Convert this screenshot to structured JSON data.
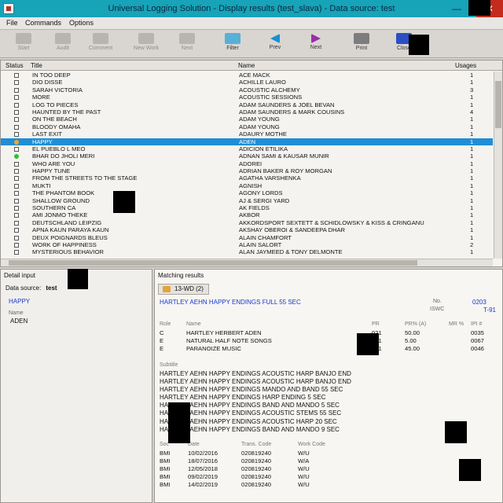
{
  "window": {
    "title": "Universal Logging Solution  -  Display results (test_slava) - Data source: test",
    "minimize_glyph": "—",
    "maximize_glyph": "☐",
    "close_glyph": "✕",
    "close_color": "#c42b1c",
    "titlebar_color": "#17a3b8"
  },
  "menu": {
    "file": "File",
    "commands": "Commands",
    "options": "Options"
  },
  "toolbar": {
    "start_label": "Start",
    "audit_label": "Audit",
    "comment_label": "Comment",
    "new_work_label": "New Work",
    "next_disabled_label": "Next",
    "filter_label": "Filter",
    "prev_label": "Prev",
    "next_label": "Next",
    "print_label": "Print",
    "close_label": "Close"
  },
  "results": {
    "headers": {
      "status": "Status",
      "title": "Title",
      "name": "Name",
      "usages": "Usages"
    },
    "selection_color": "#1f8ed6",
    "rows": [
      {
        "title": "IN TOO DEEP",
        "name": "ACE MACK",
        "usages": "1",
        "status": "none"
      },
      {
        "title": "DIO DISSE",
        "name": "ACHILLE LAURO",
        "usages": "1",
        "status": "none"
      },
      {
        "title": "SARAH VICTORIA",
        "name": "ACOUSTIC ALCHEMY",
        "usages": "3",
        "status": "none"
      },
      {
        "title": "MORE",
        "name": "ACOUSTIC SESSIONS",
        "usages": "1",
        "status": "none"
      },
      {
        "title": "LOG TO PIECES",
        "name": "ADAM SAUNDERS & JOEL BEVAN",
        "usages": "1",
        "status": "none"
      },
      {
        "title": "HAUNTED BY THE PAST",
        "name": "ADAM SAUNDERS & MARK COUSINS",
        "usages": "4",
        "status": "none"
      },
      {
        "title": "ON THE BEACH",
        "name": "ADAM YOUNG",
        "usages": "1",
        "status": "none"
      },
      {
        "title": "BLOODY OMAHA",
        "name": "ADAM YOUNG",
        "usages": "1",
        "status": "none"
      },
      {
        "title": "LAST EXIT",
        "name": "ADAURY MOTHE",
        "usages": "1",
        "status": "none"
      },
      {
        "title": "HAPPY",
        "name": "ADEN",
        "usages": "1",
        "status": "selected"
      },
      {
        "title": "EL PUEBLO L MEO",
        "name": "ADICION ETILIKA",
        "usages": "1",
        "status": "none"
      },
      {
        "title": "BHAR DO JHOLI MERI",
        "name": "ADNAN SAMI & KAUSAR MUNIR",
        "usages": "1",
        "status": "green"
      },
      {
        "title": "WHO ARE YOU",
        "name": "ADOREI",
        "usages": "1",
        "status": "none"
      },
      {
        "title": "HAPPY TUNE",
        "name": "ADRIAN BAKER & ROY MORGAN",
        "usages": "1",
        "status": "none"
      },
      {
        "title": "FROM THE STREETS TO THE STAGE",
        "name": "AGATHA VARSHENKA",
        "usages": "1",
        "status": "none"
      },
      {
        "title": "MUKTI",
        "name": "AGNISH",
        "usages": "1",
        "status": "none"
      },
      {
        "title": "THE PHANTOM BOOK",
        "name": "AGONY LORDS",
        "usages": "1",
        "status": "none"
      },
      {
        "title": "SHALLOW GROUND",
        "name": "AJ & SERGI YARD",
        "usages": "1",
        "status": "none"
      },
      {
        "title": "SOUTHERN CA",
        "name": "AK FIELDS",
        "usages": "1",
        "status": "none"
      },
      {
        "title": "AMI JONMO THEKE",
        "name": "AKBOR",
        "usages": "1",
        "status": "none"
      },
      {
        "title": "DEUTSCHLAND  LEIPZIG",
        "name": "AKKORDSPORT SEXTETT & SCHIDLOWSKY & KISS & CRINGANU",
        "usages": "1",
        "status": "none"
      },
      {
        "title": "APNA KAUN PARAYA KAUN",
        "name": "AKSHAY OBEROI & SANDEEPA DHAR",
        "usages": "1",
        "status": "none"
      },
      {
        "title": "DEUX POIGNARDS BLEUS",
        "name": "ALAIN CHAMFORT",
        "usages": "1",
        "status": "none"
      },
      {
        "title": "WORK OF HAPPINESS",
        "name": "ALAIN SALORT",
        "usages": "2",
        "status": "none"
      },
      {
        "title": "MYSTERIOUS BEHAVIOR",
        "name": "ALAN JAYMEED & TONY DELMONTE",
        "usages": "1",
        "status": "none"
      }
    ]
  },
  "detail": {
    "pane_title": "Detail input",
    "data_source_label": "Data source:",
    "data_source_value": "test",
    "title": "HAPPY",
    "name_label": "Name",
    "name": "ADEN"
  },
  "matching": {
    "pane_title": "Matching results",
    "tab_label": "13-WD (2)",
    "work_title": "HARTLEY AEHN HAPPY ENDINGS FULL 55 SEC",
    "no_label": "No.",
    "no_value": "0203",
    "iswc_label": "ISWC",
    "iswc_value": "T-91",
    "role_headers": {
      "role": "Role",
      "name": "Name",
      "pr": "PR",
      "pr_amount": "PR% (A)",
      "mr": "MR %",
      "ipi": "IPI #"
    },
    "roles": [
      {
        "role": "C",
        "name": "HARTLEY HERBERT ADEN",
        "pr": "021",
        "pr_amount": "50.00",
        "mr": "",
        "ipi": "0035"
      },
      {
        "role": "E",
        "name": "NATURAL HALF NOTE SONGS",
        "pr": "021",
        "pr_amount": "5.00",
        "mr": "",
        "ipi": "0067"
      },
      {
        "role": "E",
        "name": "PARANOIZE MUSIC",
        "pr": "021",
        "pr_amount": "45.00",
        "mr": "",
        "ipi": "0046"
      }
    ],
    "subtitles_label": "Subtitle",
    "subtitles": [
      "HARTLEY AEHN HAPPY ENDINGS ACOUSTIC HARP BANJO END",
      "HARTLEY AEHN HAPPY ENDINGS ACOUSTIC HARP BANJO END",
      "HARTLEY AEHN HAPPY ENDINGS MANDO AND BAND 55 SEC",
      "HARTLEY AEHN HAPPY ENDINGS HARP ENDING 5 SEC",
      "HARTLEY AEHN HAPPY ENDINGS BAND AND MANDO 5 SEC",
      "HARTLEY AEHN HAPPY ENDINGS ACOUSTIC STEMS 55 SEC",
      "HARTLEY AEHN HAPPY ENDINGS ACOUSTIC HARP 20 SEC",
      "HARTLEY AEHN HAPPY ENDINGS BAND AND MANDO 9 SEC"
    ],
    "usage_headers": {
      "soc": "Soc",
      "date": "Date",
      "trans_code": "Trans. Code",
      "work_code": "Work Code"
    },
    "usages": [
      {
        "soc": "BMI",
        "date": "10/02/2016",
        "trans_code": "020819240",
        "work_code": "W/U"
      },
      {
        "soc": "BMI",
        "date": "18/07/2016",
        "trans_code": "020819240",
        "work_code": "W/A"
      },
      {
        "soc": "BMI",
        "date": "12/05/2018",
        "trans_code": "020819240",
        "work_code": "W/U"
      },
      {
        "soc": "BMI",
        "date": "09/02/2019",
        "trans_code": "020819240",
        "work_code": "W/U"
      },
      {
        "soc": "BMI",
        "date": "14/02/2019",
        "trans_code": "020819240",
        "work_code": "W/U"
      }
    ]
  }
}
